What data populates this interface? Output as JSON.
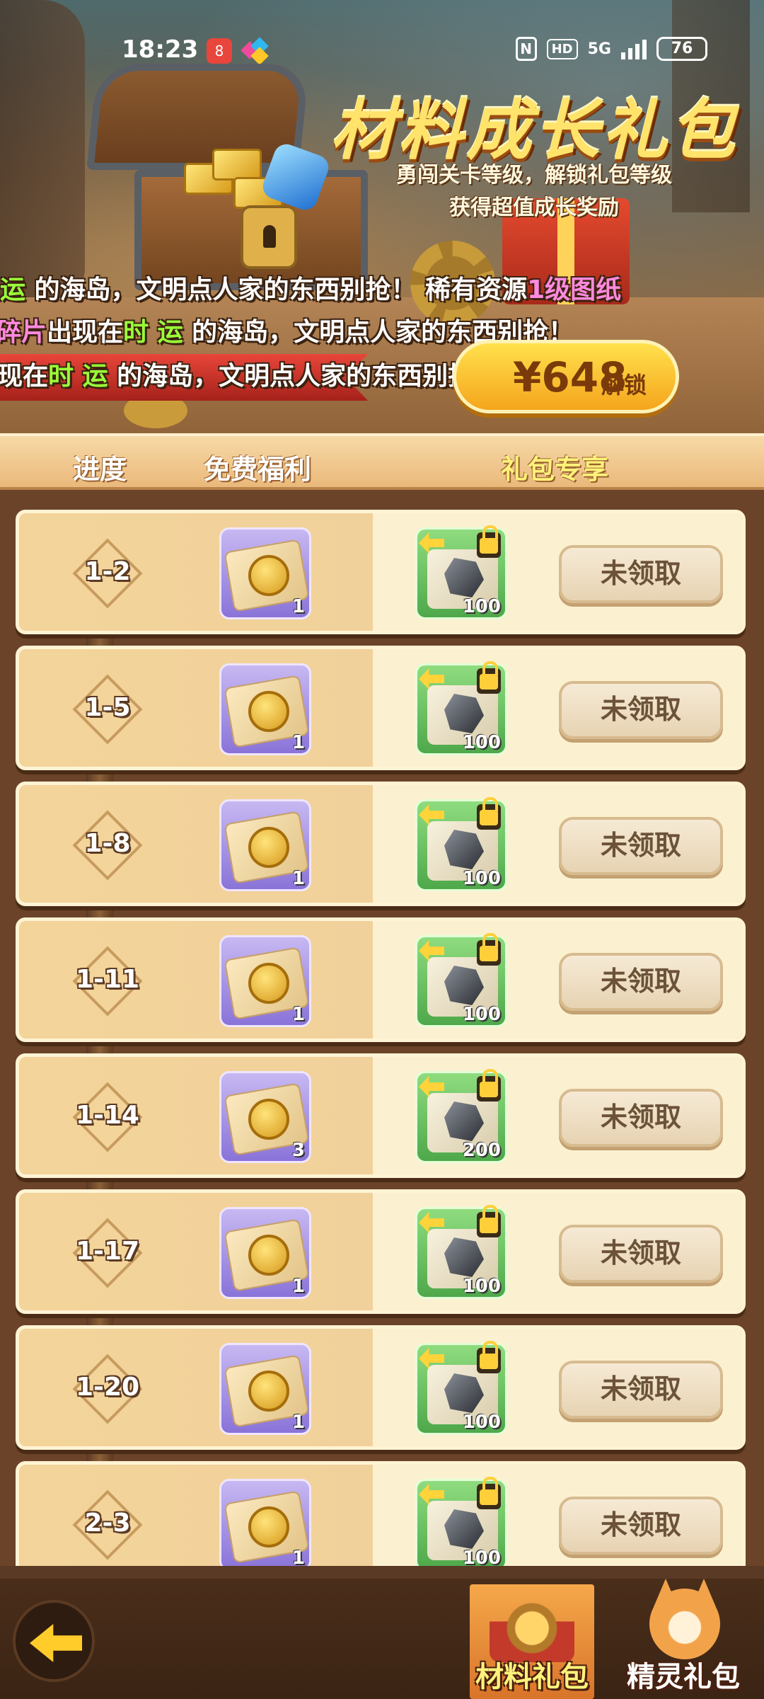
{
  "status_bar": {
    "time": "18:23",
    "network": "5G",
    "hd": "HD",
    "battery": "76"
  },
  "banner": {
    "title": "材料成长礼包",
    "subtitle_line1": "勇闯关卡等级，解锁礼包等级",
    "subtitle_line2": "获得超值成长奖励",
    "marquee": [
      {
        "parts": [
          {
            "t": "运",
            "c": "green"
          },
          {
            "t": " 的海岛，文明点人家的东西别抢！",
            "c": "white"
          },
          {
            "t": "        稀有资源",
            "c": "white"
          },
          {
            "t": "1级图纸",
            "c": "pink"
          }
        ]
      },
      {
        "parts": [
          {
            "t": "碎片",
            "c": "pink"
          },
          {
            "t": "出现在",
            "c": "white"
          },
          {
            "t": "时 运",
            "c": "green"
          },
          {
            "t": " 的海岛，文明点人家的东西别抢！",
            "c": "white"
          }
        ]
      },
      {
        "parts": [
          {
            "t": "现在",
            "c": "white"
          },
          {
            "t": "时 运",
            "c": "green"
          },
          {
            "t": " 的海岛，文明点人家的东西别抢！",
            "c": "white"
          }
        ]
      }
    ],
    "price": "¥648",
    "unlock_label": "解锁"
  },
  "header": {
    "progress": "进度",
    "free": "免费福利",
    "gift": "礼包专享"
  },
  "rows": [
    {
      "level": "1-2",
      "free_qty": "1",
      "paid_qty": "100",
      "status": "未领取"
    },
    {
      "level": "1-5",
      "free_qty": "1",
      "paid_qty": "100",
      "status": "未领取"
    },
    {
      "level": "1-8",
      "free_qty": "1",
      "paid_qty": "100",
      "status": "未领取"
    },
    {
      "level": "1-11",
      "free_qty": "1",
      "paid_qty": "100",
      "status": "未领取"
    },
    {
      "level": "1-14",
      "free_qty": "3",
      "paid_qty": "200",
      "status": "未领取"
    },
    {
      "level": "1-17",
      "free_qty": "1",
      "paid_qty": "100",
      "status": "未领取"
    },
    {
      "level": "1-20",
      "free_qty": "1",
      "paid_qty": "100",
      "status": "未领取"
    },
    {
      "level": "2-3",
      "free_qty": "1",
      "paid_qty": "100",
      "status": "未领取"
    }
  ],
  "bottom_nav": {
    "tab_material": "材料礼包",
    "tab_spirit": "精灵礼包"
  },
  "colors": {
    "accent_yellow": "#ffe36a",
    "marquee_green": "#9aff3a",
    "marquee_pink": "#ff8adf"
  }
}
